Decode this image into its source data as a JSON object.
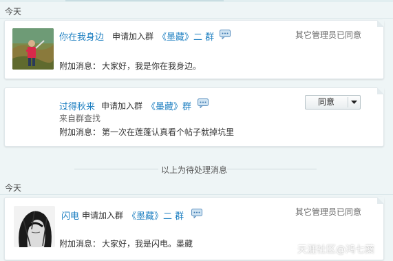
{
  "sections": [
    {
      "day_label": "今天"
    },
    {
      "day_label": "今天"
    }
  ],
  "requests": [
    {
      "name": "你在我身边",
      "action": "申请加入群",
      "group": "《墨藏》二 群",
      "status": "其它管理员已同意",
      "message_label": "附加消息：",
      "message": "大家好，我是你在我身边。"
    },
    {
      "name": "过得秋来",
      "action": "申请加入群",
      "group": "《墨藏》群",
      "source": "来自群查找",
      "message_label": "附加消息：",
      "message": "第一次在莲蓬认真看个帖子就掉坑里",
      "button_label": "同意"
    },
    {
      "name": "闪电",
      "action": "申请加入群",
      "group": "《墨藏》二 群",
      "status": "其它管理员已同意",
      "message_label": "附加消息：",
      "message": "大家好，我是闪电。墨藏"
    }
  ],
  "divider_text": "以上为待处理消息",
  "watermark": "天涯社区@鸿七蘖",
  "colors": {
    "link": "#1d7fc1",
    "background": "#eef5f6"
  },
  "icons": [
    "chat-bubble-icon",
    "dropdown-arrow-icon"
  ]
}
